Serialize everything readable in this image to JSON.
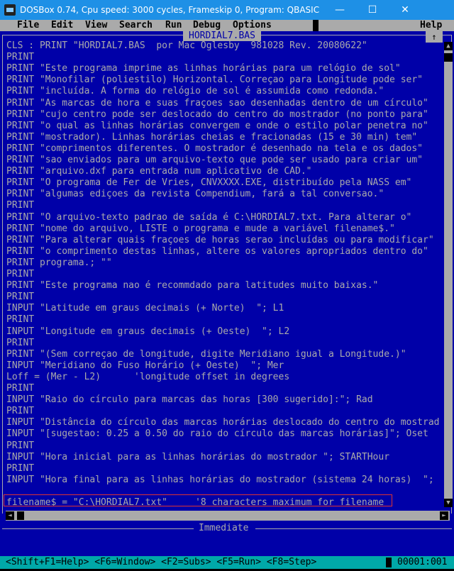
{
  "window": {
    "title": "DOSBox 0.74, Cpu speed:     3000 cycles, Frameskip  0, Program:  QBASIC",
    "minimize_glyph": "—",
    "maximize_glyph": "☐",
    "close_glyph": "✕"
  },
  "menu": {
    "items": [
      "File",
      "Edit",
      "View",
      "Search",
      "Run",
      "Debug",
      "Options",
      "Help"
    ]
  },
  "editor": {
    "file_title": "HORDIAL7.BAS",
    "maximize_glyph": "↑",
    "lines": [
      "CLS : PRINT \"HORDIAL7.BAS  por Mac Oglesby  981028 Rev. 20080622\"",
      "PRINT",
      "PRINT \"Este programa imprime as linhas horárias para um relógio de sol\"",
      "PRINT \"Monofilar (poliestilo) Horizontal. Correçao para Longitude pode ser\"",
      "PRINT \"incluída. A forma do relógio de sol é assumida como redonda.\"",
      "PRINT \"As marcas de hora e suas fraçoes sao desenhadas dentro de um círculo\"",
      "PRINT \"cujo centro pode ser deslocado do centro do mostrador (no ponto para\"",
      "PRINT \"o qual as linhas horárias convergem e onde o estilo polar penetra no\"",
      "PRINT \"mostrador). Linhas horárias cheias e fracionadas (15 e 30 min) tem\"",
      "PRINT \"comprimentos diferentes. O mostrador é desenhado na tela e os dados\"",
      "PRINT \"sao enviados para um arquivo-texto que pode ser usado para criar um\"",
      "PRINT \"arquivo.dxf para entrada num aplicativo de CAD.\"",
      "PRINT \"O programa de Fer de Vries, CNVXXXX.EXE, distribuído pela NASS em\"",
      "PRINT \"algumas ediçoes da revista Compendium, fará a tal conversao.\"",
      "PRINT",
      "PRINT \"O arquivo-texto padrao de saída é C:\\HORDIAL7.txt. Para alterar o\"",
      "PRINT \"nome do arquivo, LISTE o programa e mude a variável filename$.\"",
      "PRINT \"Para alterar quais fraçoes de horas serao incluídas ou para modificar\"",
      "PRINT \"o comprimento destas linhas, altere os valores apropriados dentro do\"",
      "PRINT programa.; \"\"",
      "PRINT",
      "PRINT \"Este programa nao é recommdado para latitudes muito baixas.\"",
      "PRINT",
      "INPUT \"Latitude em graus decimais (+ Norte)  \"; L1",
      "PRINT",
      "INPUT \"Longitude em graus decimais (+ Oeste)  \"; L2",
      "PRINT",
      "PRINT \"(Sem correçao de longitude, digite Meridiano igual a Longitude.)\"",
      "INPUT \"Meridiano do Fuso Horário (+ Oeste)  \"; Mer",
      "Loff = (Mer - L2)      'longitude offset in degrees",
      "PRINT",
      "INPUT \"Raio do círculo para marcas das horas [300 sugerido]:\"; Rad",
      "PRINT",
      "INPUT \"Distância do círculo das marcas horárias deslocado do centro do mostrad",
      "INPUT \"[sugestao: 0.25 a 0.50 do raio do círculo das marcas horárias]\"; Oset",
      "PRINT",
      "INPUT \"Hora inicial para as linhas horárias do mostrador \"; STARTHour",
      "PRINT",
      "INPUT \"Hora final para as linhas horárias do mostrador (sistema 24 horas)  \";",
      "",
      "filename$ = \"C:\\HORDIAL7.txt\"     '8 characters maximum for filename"
    ]
  },
  "scrollbar": {
    "up_glyph": "▲",
    "down_glyph": "▼",
    "left_glyph": "◄",
    "right_glyph": "►"
  },
  "immediate": {
    "title": "Immediate"
  },
  "status": {
    "shortcuts": "<Shift+F1=Help> <F6=Window> <F2=Subs> <F5=Run> <F8=Step>",
    "position": "00001:001"
  },
  "colors": {
    "editor_bg": "#0000a8",
    "text": "#aaaaaa",
    "menu_bg": "#aaaaaa",
    "status_bg": "#00a8a8",
    "titlebar_bg": "#1e90e6"
  }
}
